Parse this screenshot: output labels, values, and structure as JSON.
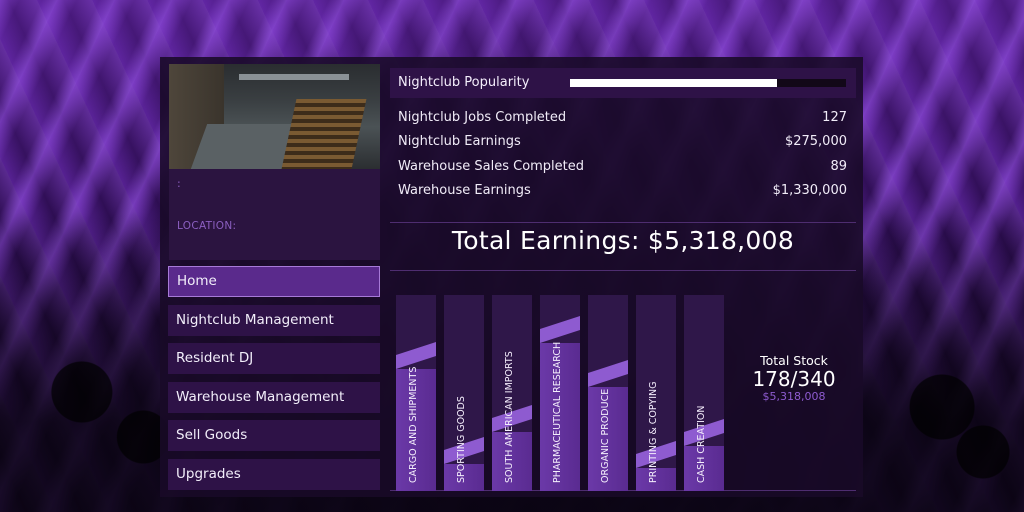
{
  "sidebar": {
    "colon": ":",
    "location_label": "LOCATION:",
    "menu": [
      {
        "label": "Home",
        "active": true
      },
      {
        "label": "Nightclub Management",
        "active": false
      },
      {
        "label": "Resident DJ",
        "active": false
      },
      {
        "label": "Warehouse Management",
        "active": false
      },
      {
        "label": "Sell Goods",
        "active": false
      },
      {
        "label": "Upgrades",
        "active": false
      }
    ]
  },
  "popularity": {
    "label": "Nightclub Popularity",
    "level": 0.75
  },
  "stats": [
    {
      "label": "Nightclub Jobs Completed",
      "value": "127"
    },
    {
      "label": "Nightclub Earnings",
      "value": "$275,000"
    },
    {
      "label": "Warehouse Sales Completed",
      "value": "89"
    },
    {
      "label": "Warehouse Earnings",
      "value": "$1,330,000"
    }
  ],
  "total": "Total Earnings: $5,318,008",
  "goods": [
    {
      "label": "CARGO AND SHIPMENTS",
      "level": 0.68
    },
    {
      "label": "SPORTING GOODS",
      "level": 0.15
    },
    {
      "label": "SOUTH AMERICAN IMPORTS",
      "level": 0.33
    },
    {
      "label": "PHARMACEUTICAL RESEARCH",
      "level": 0.82
    },
    {
      "label": "ORGANIC PRODUCE",
      "level": 0.58
    },
    {
      "label": "PRINTING & COPYING",
      "level": 0.13
    },
    {
      "label": "CASH CREATION",
      "level": 0.25
    }
  ],
  "stock": {
    "title": "Total Stock",
    "count": "178/340",
    "earnings": "$5,318,008"
  },
  "colors": {
    "accent": "#8e5bd0",
    "panel": "#2e1247",
    "active": "#5a2a8c"
  }
}
